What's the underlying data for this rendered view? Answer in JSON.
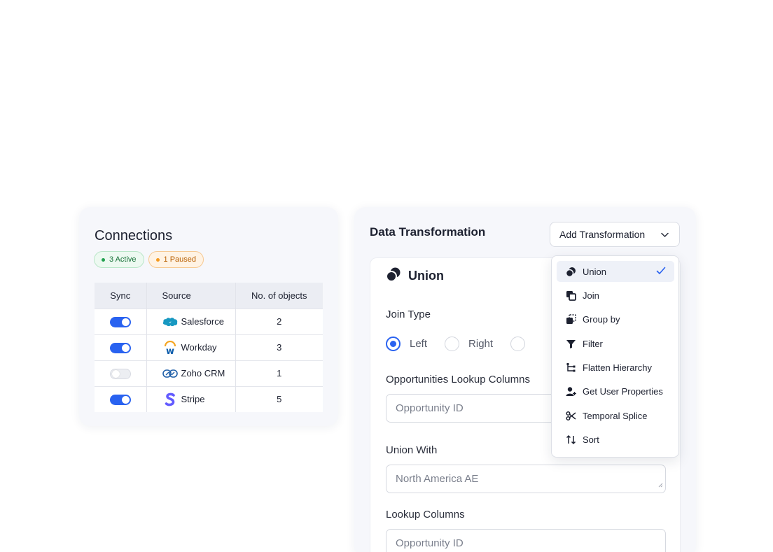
{
  "connections": {
    "title": "Connections",
    "badges": {
      "active": "3 Active",
      "paused": "1 Paused"
    },
    "headers": {
      "sync": "Sync",
      "source": "Source",
      "count": "No. of objects"
    },
    "rows": [
      {
        "source": "Salesforce",
        "count": "2",
        "sync": true,
        "icon": "salesforce-icon"
      },
      {
        "source": "Workday",
        "count": "3",
        "sync": true,
        "icon": "workday-icon"
      },
      {
        "source": "Zoho CRM",
        "count": "1",
        "sync": false,
        "icon": "zoho-icon"
      },
      {
        "source": "Stripe",
        "count": "5",
        "sync": true,
        "icon": "stripe-icon"
      }
    ]
  },
  "transformation": {
    "title": "Data Transformation",
    "add_button": "Add Transformation",
    "panel_title": "Union",
    "join_type_label": "Join Type",
    "join_options": [
      "Left",
      "Right"
    ],
    "selected_join": "Left",
    "opp_lookup_label": "Opportunities Lookup Columns",
    "opp_lookup_placeholder": "Opportunity ID",
    "union_with_label": "Union With",
    "union_with_placeholder": "North America AE",
    "lookup_label": "Lookup Columns",
    "lookup_placeholder": "Opportunity ID"
  },
  "dropdown": {
    "selected": "Union",
    "items": [
      {
        "label": "Union",
        "icon": "union-icon"
      },
      {
        "label": "Join",
        "icon": "join-icon"
      },
      {
        "label": "Group by",
        "icon": "group-by-icon"
      },
      {
        "label": "Filter",
        "icon": "filter-icon"
      },
      {
        "label": "Flatten Hierarchy",
        "icon": "flatten-hierarchy-icon"
      },
      {
        "label": "Get User Properties",
        "icon": "user-properties-icon"
      },
      {
        "label": "Temporal Splice",
        "icon": "scissors-icon"
      },
      {
        "label": "Sort",
        "icon": "sort-icon"
      }
    ]
  },
  "colors": {
    "accent": "#2962f0",
    "active_green": "#22a04f",
    "paused_orange": "#f59a1f"
  }
}
